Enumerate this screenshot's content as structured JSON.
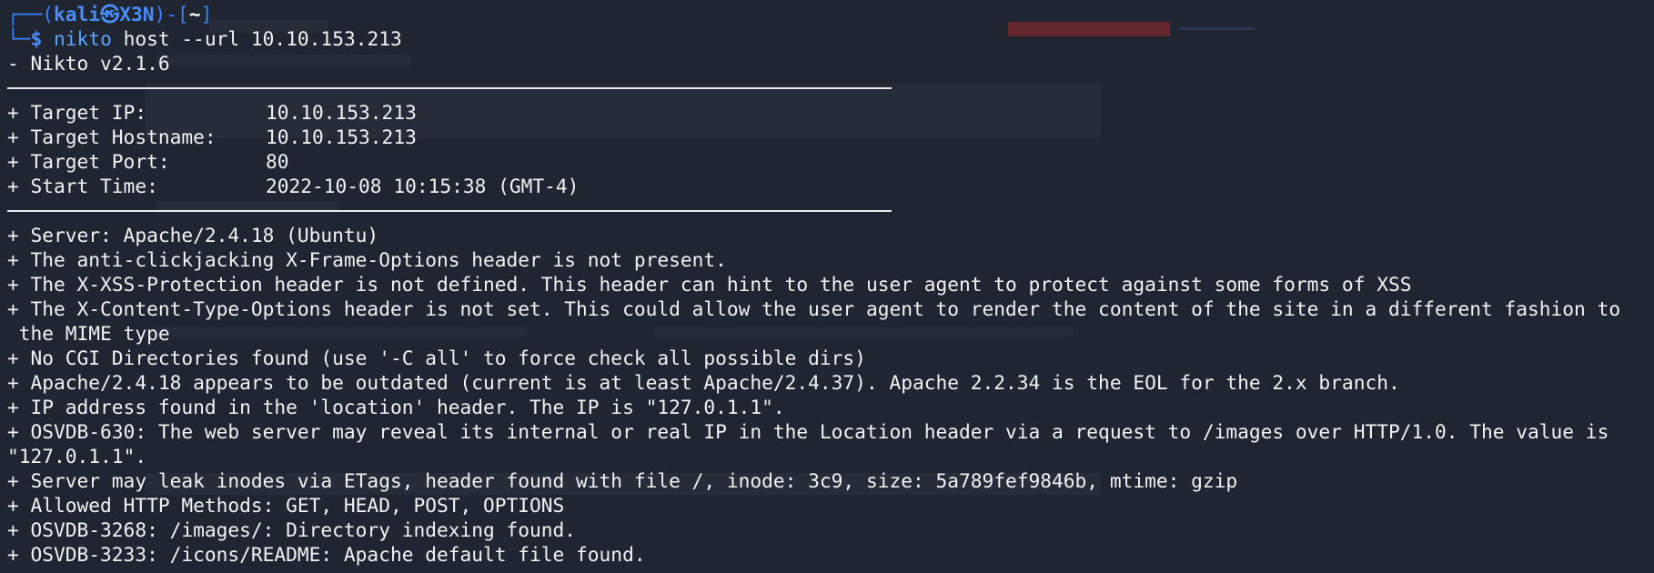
{
  "prompt": {
    "frame_top": "┌──(",
    "user": "kali",
    "skull": "㉿",
    "host": "X3N",
    "frame_mid": ")-[",
    "dir": "~",
    "frame_end": "]",
    "frame_bottom": "└─",
    "dollar": "$",
    "command_name": "nikto",
    "command_args": " host --url 10.10.153.213"
  },
  "banner": "- Nikto v2.1.6",
  "target_info": [
    {
      "key": "+ Target IP:",
      "value": "10.10.153.213"
    },
    {
      "key": "+ Target Hostname:",
      "value": "10.10.153.213"
    },
    {
      "key": "+ Target Port:",
      "value": "80"
    },
    {
      "key": "+ Start Time:",
      "value": "2022-10-08 10:15:38 (GMT-4)"
    }
  ],
  "findings": [
    "+ Server: Apache/2.4.18 (Ubuntu)",
    "+ The anti-clickjacking X-Frame-Options header is not present.",
    "+ The X-XSS-Protection header is not defined. This header can hint to the user agent to protect against some forms of XSS",
    "+ The X-Content-Type-Options header is not set. This could allow the user agent to render the content of the site in a different fashion to",
    " the MIME type",
    "+ No CGI Directories found (use '-C all' to force check all possible dirs)",
    "+ Apache/2.4.18 appears to be outdated (current is at least Apache/2.4.37). Apache 2.2.34 is the EOL for the 2.x branch.",
    "+ IP address found in the 'location' header. The IP is \"127.0.1.1\".",
    "+ OSVDB-630: The web server may reveal its internal or real IP in the Location header via a request to /images over HTTP/1.0. The value is",
    "\"127.0.1.1\".",
    "+ Server may leak inodes via ETags, header found with file /, inode: 3c9, size: 5a789fef9846b, mtime: gzip",
    "+ Allowed HTTP Methods: GET, HEAD, POST, OPTIONS",
    "+ OSVDB-3268: /images/: Directory indexing found.",
    "+ OSVDB-3233: /icons/README: Apache default file found."
  ],
  "colors": {
    "background": "#1f2531",
    "text": "#f2f3f5",
    "prompt_accent": "#4a8cf6",
    "command": "#5da3ff"
  }
}
